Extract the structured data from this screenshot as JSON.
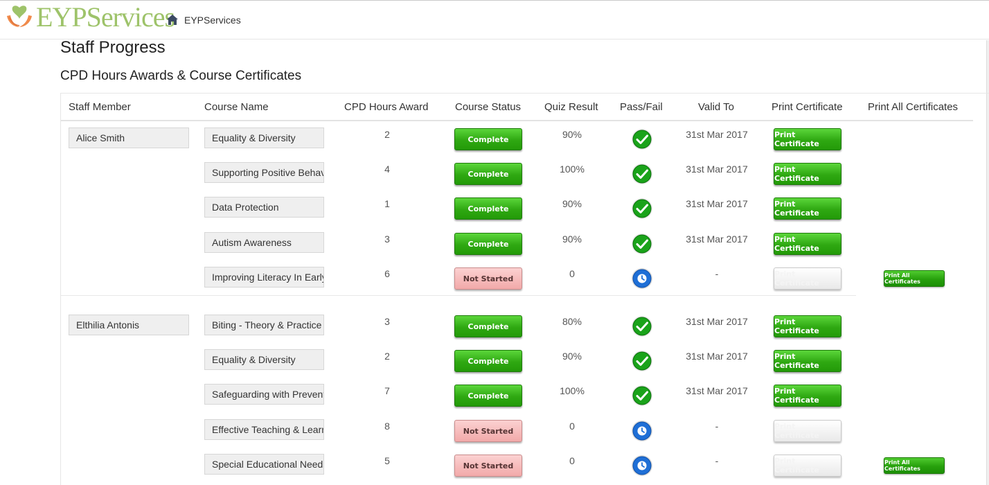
{
  "app": {
    "logo_text": "EYPServices",
    "nav_home_label": "EYPServices"
  },
  "page": {
    "title": "Staff Progress",
    "section_title": "CPD Hours Awards & Course Certificates"
  },
  "table": {
    "headers": {
      "staff": "Staff Member",
      "course": "Course Name",
      "hours": "CPD Hours Award",
      "status": "Course Status",
      "quiz": "Quiz Result",
      "passfail": "Pass/Fail",
      "valid": "Valid To",
      "print": "Print Certificate",
      "printall": "Print All Certificates"
    },
    "print_label": "Print Certificate",
    "print_all_label": "Print All Certificates",
    "staff": [
      {
        "name": "Alice Smith",
        "courses": [
          {
            "course": "Equality & Diversity",
            "hours": "2",
            "status": "Complete",
            "quiz": "90%",
            "passfail": "pass",
            "valid": "31st Mar 2017",
            "print_enabled": true
          },
          {
            "course": "Supporting Positive Behaviour",
            "hours": "4",
            "status": "Complete",
            "quiz": "100%",
            "passfail": "pass",
            "valid": "31st Mar 2017",
            "print_enabled": true
          },
          {
            "course": "Data Protection",
            "hours": "1",
            "status": "Complete",
            "quiz": "90%",
            "passfail": "pass",
            "valid": "31st Mar 2017",
            "print_enabled": true
          },
          {
            "course": "Autism Awareness",
            "hours": "3",
            "status": "Complete",
            "quiz": "90%",
            "passfail": "pass",
            "valid": "31st Mar 2017",
            "print_enabled": true
          },
          {
            "course": "Improving Literacy In Early Years",
            "hours": "6",
            "status": "Not Started",
            "quiz": "0",
            "passfail": "pending",
            "valid": "-",
            "print_enabled": false
          }
        ]
      },
      {
        "name": "Elthilia Antonis",
        "courses": [
          {
            "course": "Biting - Theory & Practice",
            "hours": "3",
            "status": "Complete",
            "quiz": "80%",
            "passfail": "pass",
            "valid": "31st Mar 2017",
            "print_enabled": true
          },
          {
            "course": "Equality & Diversity",
            "hours": "2",
            "status": "Complete",
            "quiz": "90%",
            "passfail": "pass",
            "valid": "31st Mar 2017",
            "print_enabled": true
          },
          {
            "course": "Safeguarding with Prevent",
            "hours": "7",
            "status": "Complete",
            "quiz": "100%",
            "passfail": "pass",
            "valid": "31st Mar 2017",
            "print_enabled": true
          },
          {
            "course": "Effective Teaching & Learning",
            "hours": "8",
            "status": "Not Started",
            "quiz": "0",
            "passfail": "pending",
            "valid": "-",
            "print_enabled": false
          },
          {
            "course": "Special Educational Needs",
            "hours": "5",
            "status": "Not Started",
            "quiz": "0",
            "passfail": "pending",
            "valid": "-",
            "print_enabled": false
          }
        ]
      }
    ]
  },
  "colors": {
    "complete_green": "#2fa812",
    "not_started_pink": "#f2a9a9",
    "pass_icon_green": "#1aa31a",
    "pending_icon_blue": "#1f6fd6",
    "logo_green": "#9ec36a"
  },
  "icons": {
    "home": "home-icon",
    "pass": "check-circle-icon",
    "pending": "clock-circle-icon"
  }
}
